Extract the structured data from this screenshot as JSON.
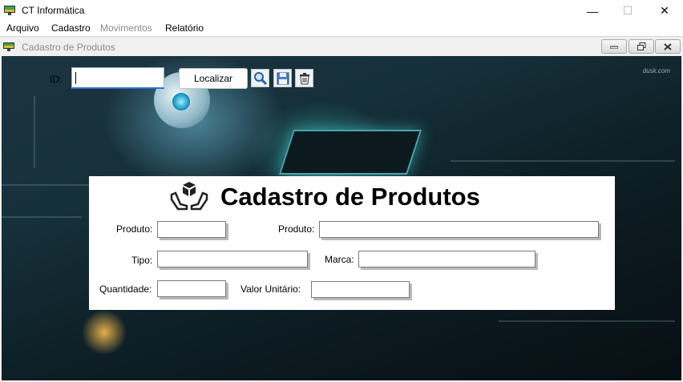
{
  "window": {
    "title": "CT Informática",
    "min_glyph": "—",
    "max_glyph": "☐",
    "close_glyph": "✕"
  },
  "menu": {
    "items": [
      "Arquivo",
      "Cadastro",
      "Movimentos",
      "Relatório"
    ]
  },
  "child_window": {
    "title": "Cadastro de Produtos"
  },
  "search": {
    "id_label": "ID:",
    "id_value": "",
    "localizar_label": "Localizar"
  },
  "background": {
    "watermark": "dusk.com"
  },
  "form": {
    "heading": "Cadastro de Produtos",
    "produto_label_1": "Produto:",
    "produto_label_2": "Produto:",
    "tipo_label": "Tipo:",
    "marca_label": "Marca:",
    "quantidade_label": "Quantidade:",
    "valor_unitario_label": "Valor Unitário:"
  },
  "colors": {
    "input_focus_border": "#2f6fd1",
    "panel_background": "#ffffff"
  }
}
